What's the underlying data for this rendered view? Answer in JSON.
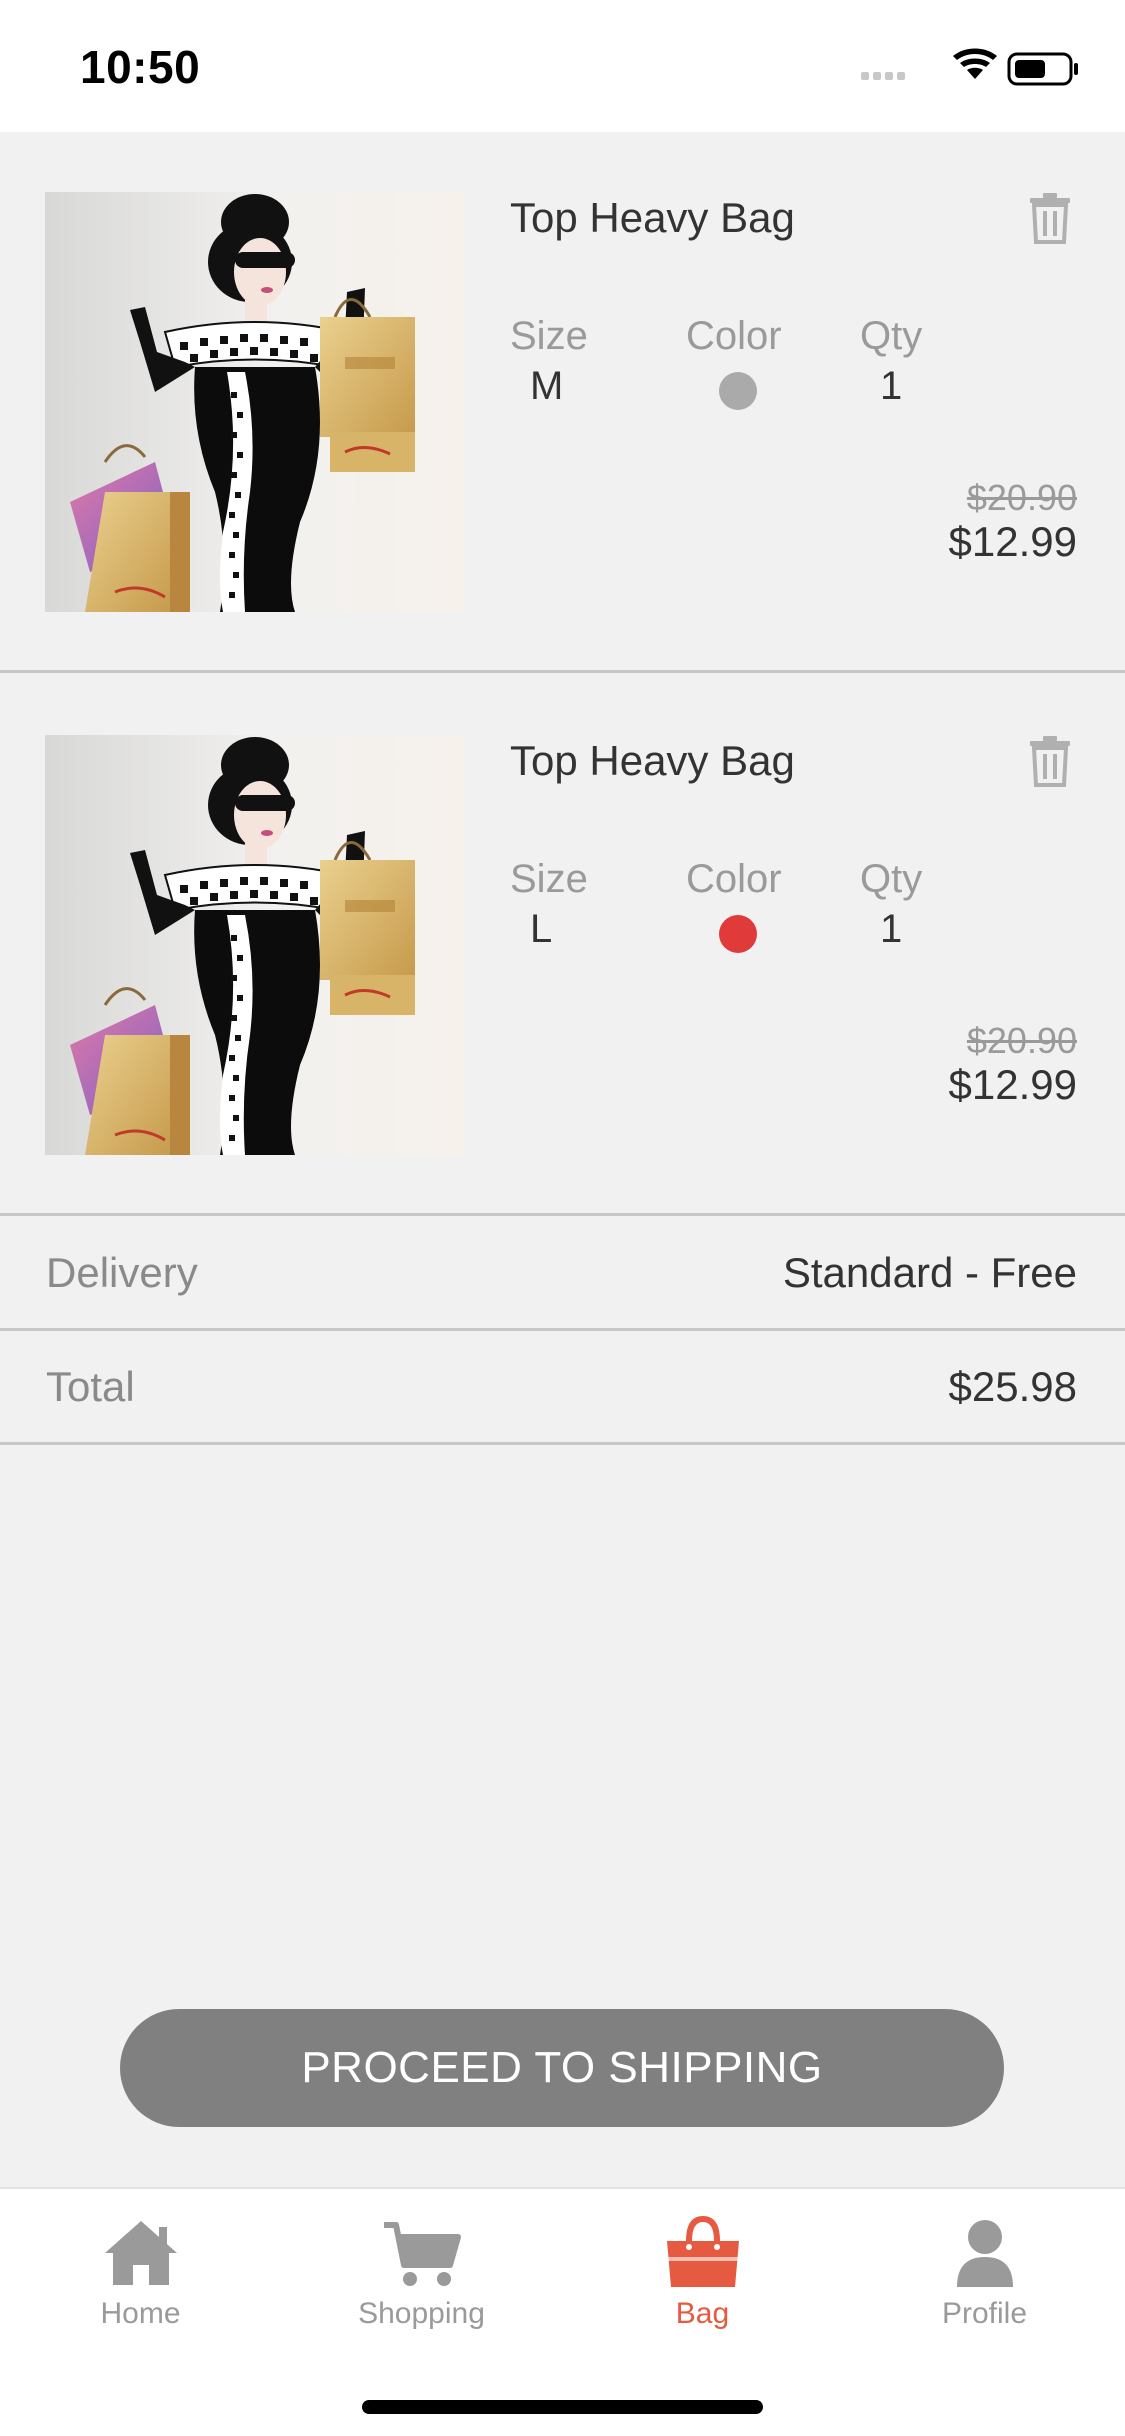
{
  "status_bar": {
    "time": "10:50"
  },
  "cart": {
    "items": [
      {
        "title": "Top Heavy Bag",
        "size_label": "Size",
        "size_value": "M",
        "color_label": "Color",
        "color_value": "#aaaaaa",
        "qty_label": "Qty",
        "qty_value": "1",
        "old_price": "$20.90",
        "new_price": "$12.99",
        "image_icon": "fashion-woman-shopping-bags-illustration"
      },
      {
        "title": "Top Heavy Bag",
        "size_label": "Size",
        "size_value": "L",
        "color_label": "Color",
        "color_value": "#e03a3a",
        "qty_label": "Qty",
        "qty_value": "1",
        "old_price": "$20.90",
        "new_price": "$12.99",
        "image_icon": "fashion-woman-shopping-bags-illustration"
      }
    ]
  },
  "summary": {
    "delivery_label": "Delivery",
    "delivery_value": "Standard - Free",
    "total_label": "Total",
    "total_value": "$25.98"
  },
  "actions": {
    "proceed_label": "PROCEED TO SHIPPING"
  },
  "tabs": [
    {
      "label": "Home",
      "icon": "home-icon",
      "active": false
    },
    {
      "label": "Shopping",
      "icon": "cart-icon",
      "active": false
    },
    {
      "label": "Bag",
      "icon": "bag-icon",
      "active": true
    },
    {
      "label": "Profile",
      "icon": "profile-icon",
      "active": false
    }
  ],
  "colors": {
    "accent": "#e65a41",
    "button": "#808080",
    "background": "#f1f1f1",
    "inactive": "#9a9a9a"
  }
}
